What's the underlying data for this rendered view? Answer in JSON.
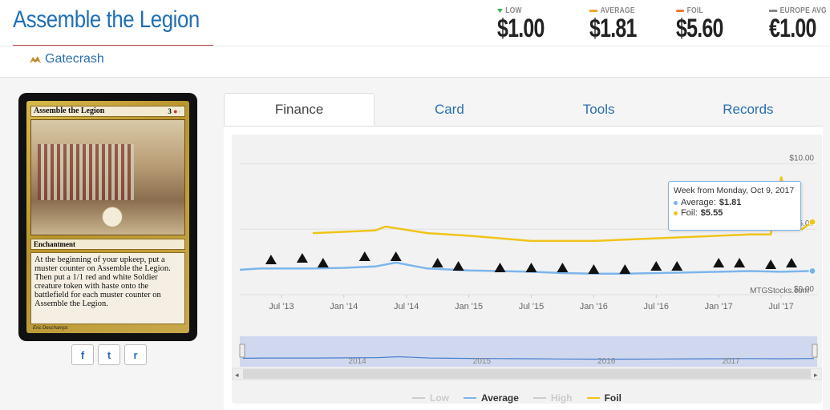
{
  "header": {
    "title": "Assemble the Legion",
    "set_name": "Gatecrash",
    "set_icon": "gatecrash-set-icon"
  },
  "prices": [
    {
      "label": "LOW",
      "value": "$1.00",
      "indicator": "triangle-down",
      "color": "#39b54a"
    },
    {
      "label": "AVERAGE",
      "value": "$1.81",
      "indicator": "bar",
      "color": "#f0a830"
    },
    {
      "label": "FOIL",
      "value": "$5.60",
      "indicator": "bar",
      "color": "#f07838"
    },
    {
      "label": "EUROPE AVG",
      "value": "€1.00",
      "indicator": "bar",
      "color": "#888888"
    }
  ],
  "card": {
    "name": "Assemble the Legion",
    "cost": "3",
    "type": "Enchantment",
    "rules_text": "At the beginning of your upkeep, put a muster counter on Assemble the Legion. Then put a 1/1 red and white Soldier creature token with haste onto the battlefield for each muster counter on Assemble the Legion.",
    "artist": "Eric Deschamps"
  },
  "social": [
    {
      "name": "facebook-share-button",
      "glyph": "f"
    },
    {
      "name": "twitter-share-button",
      "glyph": "t"
    },
    {
      "name": "reddit-share-button",
      "glyph": "r"
    }
  ],
  "tabs": [
    {
      "label": "Finance",
      "active": true
    },
    {
      "label": "Card",
      "active": false
    },
    {
      "label": "Tools",
      "active": false
    },
    {
      "label": "Records",
      "active": false
    }
  ],
  "tooltip": {
    "header": "Week from Monday, Oct 9, 2017",
    "average_label": "Average:",
    "average_value": "$1.81",
    "foil_label": "Foil:",
    "foil_value": "$5.55"
  },
  "chart_data": {
    "type": "line",
    "x_tick_labels": [
      "Jul '13",
      "Jan '14",
      "Jul '14",
      "Jan '15",
      "Jul '15",
      "Jan '16",
      "Jul '16",
      "Jan '17",
      "Jul '17"
    ],
    "y_tick_labels": [
      "$5.00",
      "$10.00",
      "$0.00"
    ],
    "credit": "MTGStocks.com",
    "series": [
      {
        "name": "Low",
        "color": "#cccccc",
        "visible": false,
        "values": []
      },
      {
        "name": "Average",
        "color": "#7cb5ec",
        "visible": true,
        "x": [
          "2013-03",
          "2013-05",
          "2013-07",
          "2013-10",
          "2014-01",
          "2014-04",
          "2014-06",
          "2014-09",
          "2015-01",
          "2015-04",
          "2015-07",
          "2015-10",
          "2016-01",
          "2016-04",
          "2016-07",
          "2016-10",
          "2017-01",
          "2017-04",
          "2017-07",
          "2017-10"
        ],
        "values": [
          1.9,
          2.0,
          2.0,
          2.0,
          2.05,
          2.15,
          2.45,
          2.0,
          1.85,
          1.8,
          1.75,
          1.65,
          1.6,
          1.6,
          1.65,
          1.7,
          1.75,
          1.8,
          1.75,
          1.81
        ]
      },
      {
        "name": "High",
        "color": "#cccccc",
        "visible": false,
        "values": []
      },
      {
        "name": "Foil",
        "color": "#f0c419",
        "visible": true,
        "x": [
          "2013-10",
          "2014-01",
          "2014-04",
          "2014-05",
          "2014-09",
          "2015-01",
          "2015-04",
          "2015-07",
          "2015-10",
          "2016-01",
          "2016-04",
          "2016-07",
          "2016-10",
          "2017-01",
          "2017-04",
          "2017-06",
          "2017-07",
          "2017-08",
          "2017-09",
          "2017-10"
        ],
        "values": [
          4.7,
          4.8,
          4.9,
          5.2,
          4.7,
          4.5,
          4.3,
          4.1,
          4.1,
          4.1,
          4.2,
          4.3,
          4.4,
          4.5,
          4.6,
          4.6,
          9.0,
          5.5,
          5.0,
          5.55
        ]
      }
    ],
    "navigator_year_labels": [
      "2014",
      "2015",
      "2016",
      "2017"
    ],
    "legend": [
      "Low",
      "Average",
      "High",
      "Foil"
    ]
  }
}
